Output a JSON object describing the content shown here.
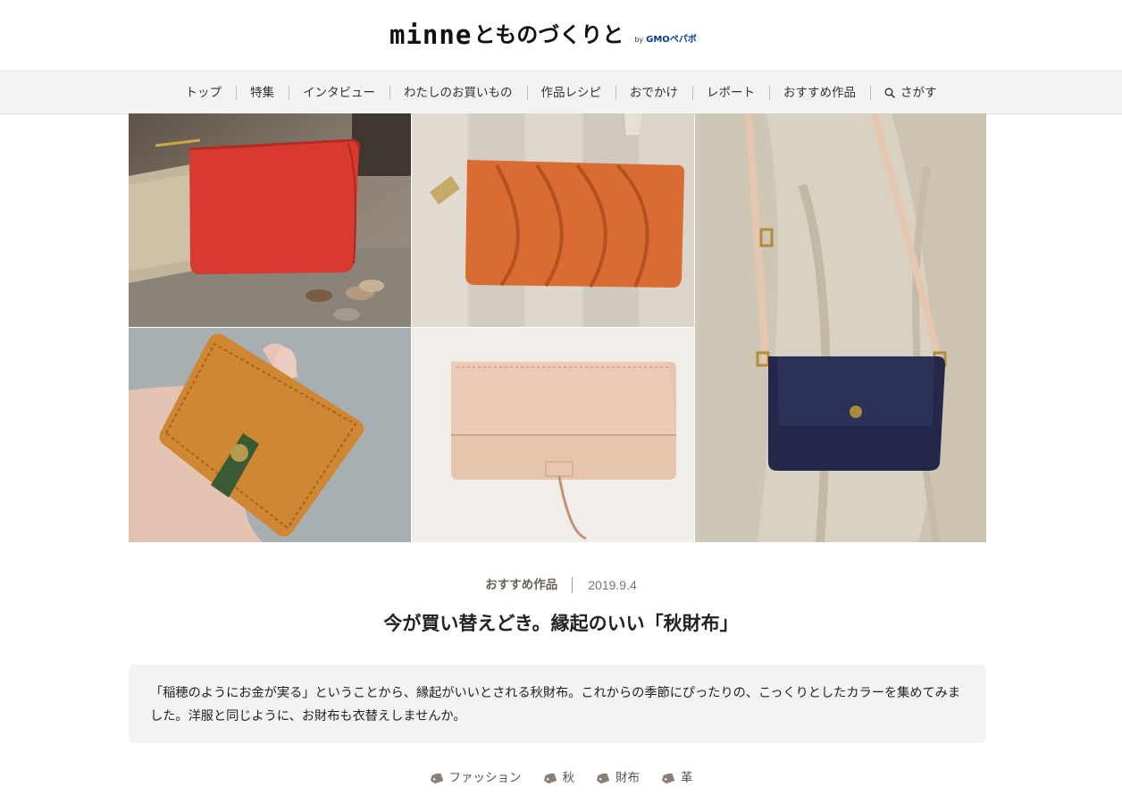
{
  "logo": {
    "main": "minne",
    "rest": "とものづくりと",
    "by": "by",
    "company": "GMOペパボ"
  },
  "nav": {
    "items": [
      {
        "label": "トップ"
      },
      {
        "label": "特集"
      },
      {
        "label": "インタビュー"
      },
      {
        "label": "わたしのお買いもの"
      },
      {
        "label": "作品レシピ"
      },
      {
        "label": "おでかけ"
      },
      {
        "label": "レポート"
      },
      {
        "label": "おすすめ作品"
      }
    ],
    "search_label": "さがす",
    "search_icon": "search-icon"
  },
  "hero": {
    "icons": [
      "red-wallet-photo",
      "orange-long-wallet-photo",
      "shoulder-bag-photo",
      "hand-wallet-photo",
      "beige-wallet-photo"
    ]
  },
  "article": {
    "category": "おすすめ作品",
    "date": "2019.9.4",
    "title": "今が買い替えどき。縁起のいい「秋財布」",
    "lead": "「稲穂のようにお金が実る」ということから、縁起がいいとされる秋財布。これからの季節にぴったりの、こっくりとしたカラーを集めてみました。洋服と同じように、お財布も衣替えしませんか。",
    "tags": [
      {
        "label": "ファッション"
      },
      {
        "label": "秋"
      },
      {
        "label": "財布"
      },
      {
        "label": "革"
      }
    ]
  },
  "colors": {
    "nav_bg": "#f3f3f3",
    "lead_bg": "#f3f3f3",
    "category_text": "#6b6257",
    "tag_icon": "#8a8079"
  }
}
